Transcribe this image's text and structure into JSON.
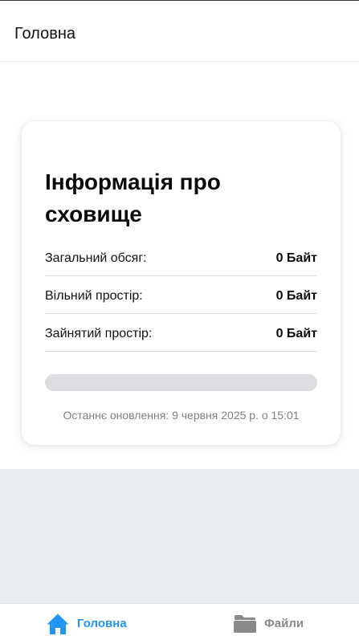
{
  "header": {
    "title": "Головна"
  },
  "storage_card": {
    "title": "Інформація про сховище",
    "rows": [
      {
        "label": "Загальний обсяг:",
        "value": "0 Байт"
      },
      {
        "label": "Вільний простір:",
        "value": "0 Байт"
      },
      {
        "label": "Зайнятий простір:",
        "value": "0 Байт"
      }
    ],
    "usage_fraction": 0,
    "last_updated": "Останнє оновлення: 9 червня 2025 р. о 15:01"
  },
  "bottom_nav": {
    "items": [
      {
        "label": "Головна",
        "icon": "home-icon",
        "active": true
      },
      {
        "label": "Файли",
        "icon": "folder-icon",
        "active": false
      }
    ]
  },
  "colors": {
    "accent": "#2196f3",
    "inactive": "#8a8a8a",
    "track": "#dcdde1",
    "page_background_lower": "#e9ecef"
  }
}
